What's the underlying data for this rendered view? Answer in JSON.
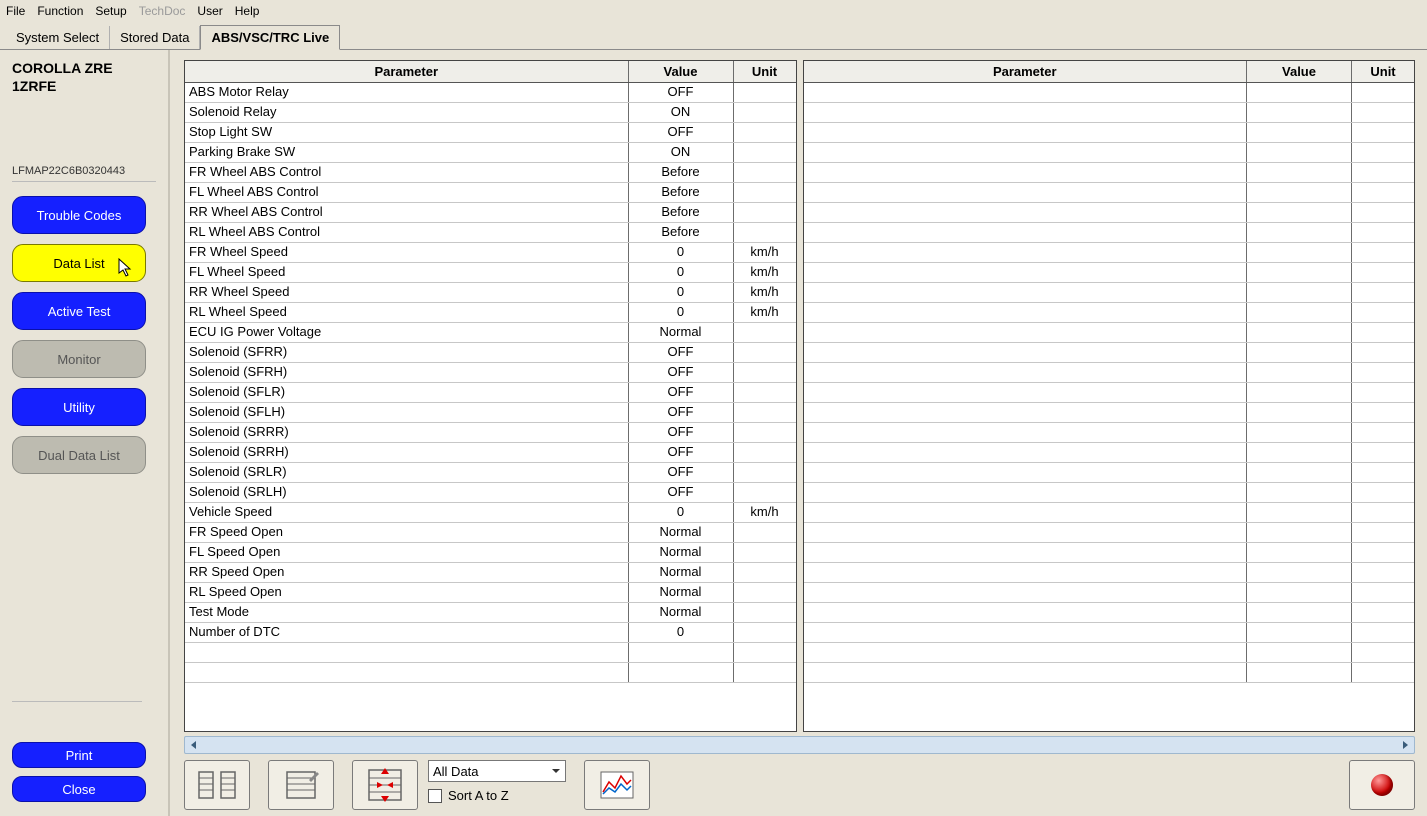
{
  "menu": {
    "items": [
      "File",
      "Function",
      "Setup",
      "TechDoc",
      "User",
      "Help"
    ],
    "disabled_idx": 3
  },
  "tabs": {
    "items": [
      "System Select",
      "Stored Data",
      "ABS/VSC/TRC Live"
    ],
    "active_idx": 2
  },
  "sidebar": {
    "vehicle_line1": "COROLLA ZRE",
    "vehicle_line2": "1ZRFE",
    "serial": "LFMAP22C6B0320443",
    "nav": [
      {
        "label": "Trouble Codes",
        "style": "blue"
      },
      {
        "label": "Data List",
        "style": "yellow"
      },
      {
        "label": "Active Test",
        "style": "blue"
      },
      {
        "label": "Monitor",
        "style": "gray"
      },
      {
        "label": "Utility",
        "style": "blue"
      },
      {
        "label": "Dual Data List",
        "style": "gray"
      }
    ],
    "print_label": "Print",
    "close_label": "Close"
  },
  "table_headers": {
    "param": "Parameter",
    "value": "Value",
    "unit": "Unit"
  },
  "table_left": [
    {
      "param": "ABS Motor Relay",
      "value": "OFF",
      "unit": ""
    },
    {
      "param": "Solenoid Relay",
      "value": "ON",
      "unit": ""
    },
    {
      "param": "Stop Light SW",
      "value": "OFF",
      "unit": ""
    },
    {
      "param": "Parking Brake SW",
      "value": "ON",
      "unit": ""
    },
    {
      "param": "FR Wheel ABS Control",
      "value": "Before",
      "unit": ""
    },
    {
      "param": "FL Wheel ABS Control",
      "value": "Before",
      "unit": ""
    },
    {
      "param": "RR Wheel ABS Control",
      "value": "Before",
      "unit": ""
    },
    {
      "param": "RL Wheel ABS Control",
      "value": "Before",
      "unit": ""
    },
    {
      "param": "FR Wheel Speed",
      "value": "0",
      "unit": "km/h"
    },
    {
      "param": "FL Wheel Speed",
      "value": "0",
      "unit": "km/h"
    },
    {
      "param": "RR Wheel Speed",
      "value": "0",
      "unit": "km/h"
    },
    {
      "param": "RL Wheel Speed",
      "value": "0",
      "unit": "km/h"
    },
    {
      "param": "ECU IG Power Voltage",
      "value": "Normal",
      "unit": ""
    },
    {
      "param": "Solenoid (SFRR)",
      "value": "OFF",
      "unit": ""
    },
    {
      "param": "Solenoid (SFRH)",
      "value": "OFF",
      "unit": ""
    },
    {
      "param": "Solenoid (SFLR)",
      "value": "OFF",
      "unit": ""
    },
    {
      "param": "Solenoid (SFLH)",
      "value": "OFF",
      "unit": ""
    },
    {
      "param": "Solenoid (SRRR)",
      "value": "OFF",
      "unit": ""
    },
    {
      "param": "Solenoid (SRRH)",
      "value": "OFF",
      "unit": ""
    },
    {
      "param": "Solenoid (SRLR)",
      "value": "OFF",
      "unit": ""
    },
    {
      "param": "Solenoid (SRLH)",
      "value": "OFF",
      "unit": ""
    },
    {
      "param": "Vehicle Speed",
      "value": "0",
      "unit": "km/h"
    },
    {
      "param": "FR Speed Open",
      "value": "Normal",
      "unit": ""
    },
    {
      "param": "FL Speed Open",
      "value": "Normal",
      "unit": ""
    },
    {
      "param": "RR Speed Open",
      "value": "Normal",
      "unit": ""
    },
    {
      "param": "RL Speed Open",
      "value": "Normal",
      "unit": ""
    },
    {
      "param": "Test Mode",
      "value": "Normal",
      "unit": ""
    },
    {
      "param": "Number of DTC",
      "value": "0",
      "unit": ""
    }
  ],
  "table_right": [],
  "toolbar": {
    "filter_selected": "All Data",
    "sort_label": "Sort A to Z",
    "sort_checked": false
  }
}
